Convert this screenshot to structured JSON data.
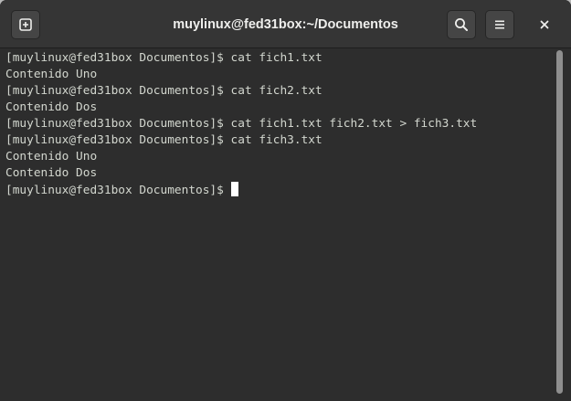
{
  "window": {
    "title": "muylinux@fed31box:~/Documentos"
  },
  "header": {
    "new_tab_icon": "new-tab-icon",
    "search_icon": "search-icon",
    "menu_icon": "hamburger-menu-icon",
    "close_icon": "close-icon"
  },
  "terminal": {
    "lines": [
      "[muylinux@fed31box Documentos]$ cat fich1.txt",
      "Contenido Uno",
      "[muylinux@fed31box Documentos]$ cat fich2.txt",
      "Contenido Dos",
      "[muylinux@fed31box Documentos]$ cat fich1.txt fich2.txt > fich3.txt",
      "[muylinux@fed31box Documentos]$ cat fich3.txt",
      "Contenido Uno",
      "Contenido Dos"
    ],
    "prompt": "[muylinux@fed31box Documentos]$ "
  },
  "colors": {
    "terminal_background": "#2d2d2d",
    "terminal_text": "#d3d7cf",
    "headerbar": "#353535",
    "title_text": "#eeeeec"
  }
}
